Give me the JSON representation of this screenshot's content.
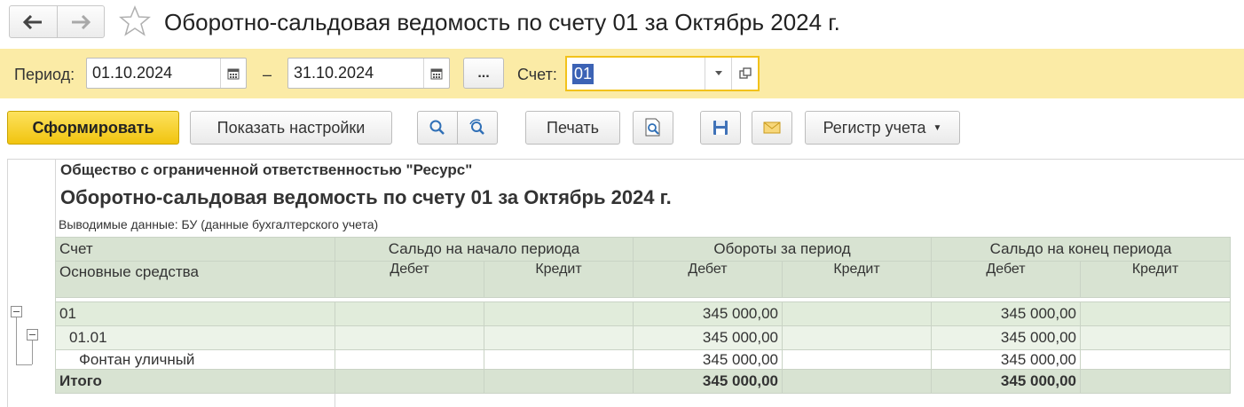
{
  "window": {
    "title": "Оборотно-сальдовая ведомость по счету 01 за Октябрь 2024 г."
  },
  "filters": {
    "period_label": "Период:",
    "date_from": "01.10.2024",
    "dash": "–",
    "date_to": "31.10.2024",
    "more_label": "...",
    "account_label": "Счет:",
    "account_value": "01"
  },
  "toolbar": {
    "generate_label": "Сформировать",
    "settings_label": "Показать настройки",
    "print_label": "Печать",
    "register_label": "Регистр учета"
  },
  "report": {
    "org": "Общество с ограниченной ответственностью \"Ресурс\"",
    "title": "Оборотно-сальдовая ведомость по счету 01 за Октябрь 2024 г.",
    "subtitle": "Выводимые данные: БУ (данные бухгалтерского учета)",
    "headers": {
      "account": "Счет",
      "subconto": "Основные средства",
      "opening": "Сальдо на начало периода",
      "turnover": "Обороты за период",
      "closing": "Сальдо на конец периода",
      "debit": "Дебет",
      "credit": "Кредит"
    },
    "rows": [
      {
        "name": "01",
        "open_debit": "",
        "open_credit": "",
        "turn_debit": "345 000,00",
        "turn_credit": "",
        "close_debit": "345 000,00",
        "close_credit": ""
      },
      {
        "name": "01.01",
        "open_debit": "",
        "open_credit": "",
        "turn_debit": "345 000,00",
        "turn_credit": "",
        "close_debit": "345 000,00",
        "close_credit": ""
      },
      {
        "name": "Фонтан уличный",
        "open_debit": "",
        "open_credit": "",
        "turn_debit": "345 000,00",
        "turn_credit": "",
        "close_debit": "345 000,00",
        "close_credit": ""
      }
    ],
    "total": {
      "name": "Итого",
      "open_debit": "",
      "open_credit": "",
      "turn_debit": "345 000,00",
      "turn_credit": "",
      "close_debit": "345 000,00",
      "close_credit": ""
    }
  },
  "colors": {
    "primary_button": "#f1c40f",
    "filter_panel": "#fbeba6",
    "table_header": "#d8e3d2",
    "selection": "#3c63b5"
  }
}
